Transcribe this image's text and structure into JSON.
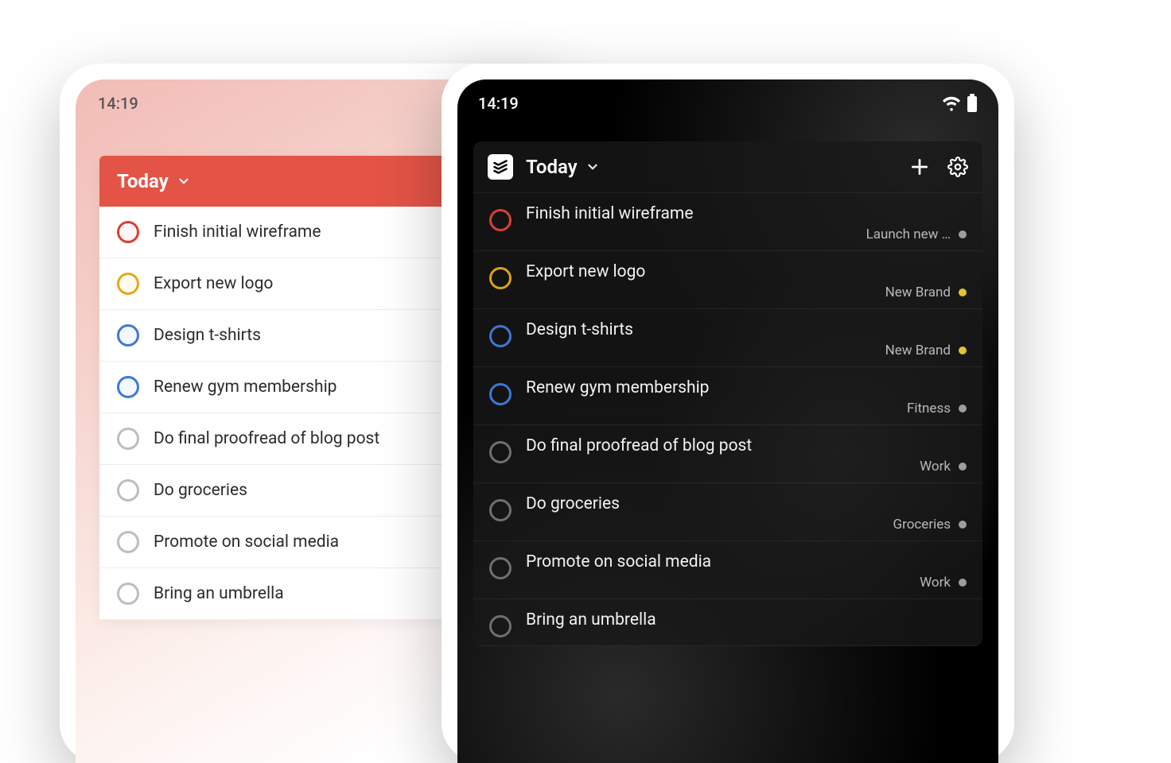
{
  "status_time": "14:19",
  "header_label": "Today",
  "light": {
    "tasks": [
      {
        "title": "Finish initial wireframe",
        "circle": "c-red"
      },
      {
        "title": "Export new logo",
        "circle": "c-yellow"
      },
      {
        "title": "Design t-shirts",
        "circle": "c-blue"
      },
      {
        "title": "Renew gym membership",
        "circle": "c-blue"
      },
      {
        "title": "Do final proofread of blog post",
        "circle": "c-grey"
      },
      {
        "title": "Do groceries",
        "circle": "c-grey"
      },
      {
        "title": "Promote on social media",
        "circle": "c-grey"
      },
      {
        "title": "Bring an umbrella",
        "circle": "c-grey"
      }
    ]
  },
  "dark": {
    "tasks": [
      {
        "title": "Finish initial wireframe",
        "circle": "dc-red",
        "project": "Launch new …",
        "dot": ""
      },
      {
        "title": "Export new logo",
        "circle": "dc-yellow",
        "project": "New Brand",
        "dot": "dot-yellow"
      },
      {
        "title": "Design t-shirts",
        "circle": "dc-blue",
        "project": "New Brand",
        "dot": "dot-yellow"
      },
      {
        "title": "Renew gym membership",
        "circle": "dc-blue",
        "project": "Fitness",
        "dot": ""
      },
      {
        "title": "Do final proofread of blog post",
        "circle": "dc-grey",
        "project": "Work",
        "dot": ""
      },
      {
        "title": "Do groceries",
        "circle": "dc-grey",
        "project": "Groceries",
        "dot": ""
      },
      {
        "title": "Promote on social media",
        "circle": "dc-grey",
        "project": "Work",
        "dot": ""
      },
      {
        "title": "Bring an umbrella",
        "circle": "dc-grey",
        "project": "",
        "dot": ""
      }
    ]
  }
}
